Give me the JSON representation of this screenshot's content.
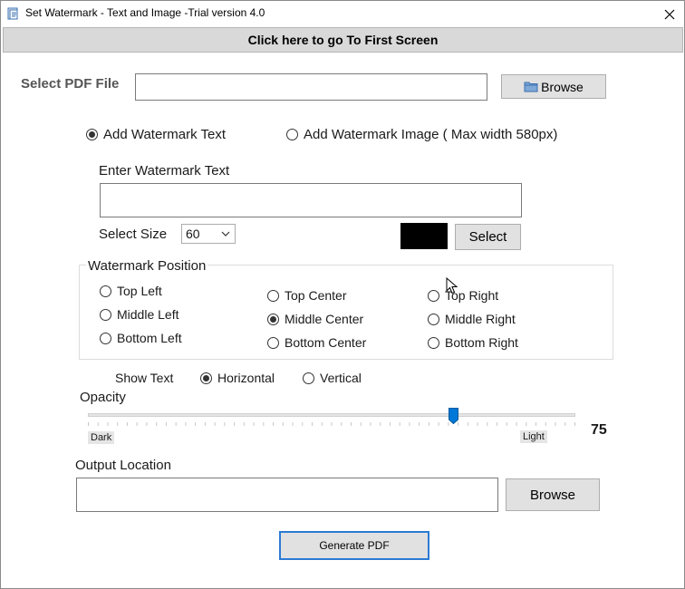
{
  "window": {
    "title": "Set Watermark  - Text and Image -Trial version 4.0",
    "close_icon": "close-icon"
  },
  "header": {
    "first_screen_label": "Click here to go To First Screen"
  },
  "pdf_file": {
    "label": "Select PDF File",
    "value": "",
    "browse_label": "Browse",
    "browse_icon": "folder-icon"
  },
  "mode": {
    "text_label": "Add Watermark Text",
    "image_label": "Add Watermark Image ( Max width 580px)",
    "selected": "text"
  },
  "watermark_text": {
    "label": "Enter Watermark Text",
    "value": ""
  },
  "size": {
    "label": "Select Size",
    "value": "60"
  },
  "color": {
    "swatch": "#000000",
    "select_label": "Select"
  },
  "position": {
    "title": "Watermark Position",
    "options": [
      "Top Left",
      "Middle Left",
      "Bottom Left",
      "Top Center",
      "Middle Center",
      "Bottom Center",
      "Top Right",
      "Middle Right",
      "Bottom Right"
    ],
    "selected": "Middle Center"
  },
  "orientation": {
    "label": "Show Text",
    "horizontal_label": "Horizontal",
    "vertical_label": "Vertical",
    "selected": "horizontal"
  },
  "opacity": {
    "label": "Opacity",
    "dark_label": "Dark",
    "light_label": "Light",
    "value": 75,
    "value_text": "75",
    "max": 100
  },
  "output": {
    "label": "Output Location",
    "value": "",
    "browse_label": "Browse"
  },
  "generate_label": "Generate PDF"
}
